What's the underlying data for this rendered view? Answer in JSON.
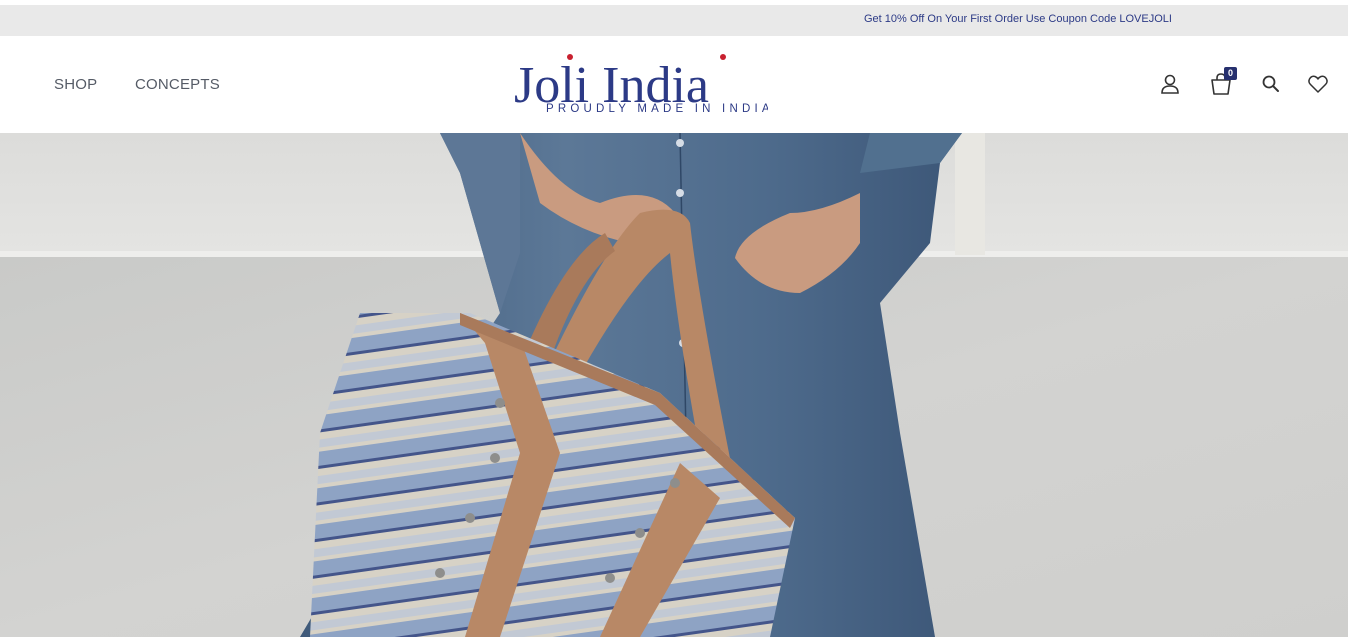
{
  "announcement": {
    "text": "Get 10% Off On Your First Order Use Coupon Code LOVEJOLI"
  },
  "nav": {
    "items": [
      {
        "label": "SHOP"
      },
      {
        "label": "CONCEPTS"
      }
    ]
  },
  "logo": {
    "name": "Joli India",
    "tagline": "PROUDLY MADE IN INDIA"
  },
  "header_icons": {
    "account": "user-icon",
    "cart": "shopping-bag-icon",
    "cart_count": "0",
    "search": "search-icon",
    "wishlist": "heart-icon"
  },
  "colors": {
    "brand_blue": "#2c3a86",
    "brand_red": "#c8202f",
    "announce_bg": "#e9e9e9",
    "nav_text": "#555b66"
  }
}
